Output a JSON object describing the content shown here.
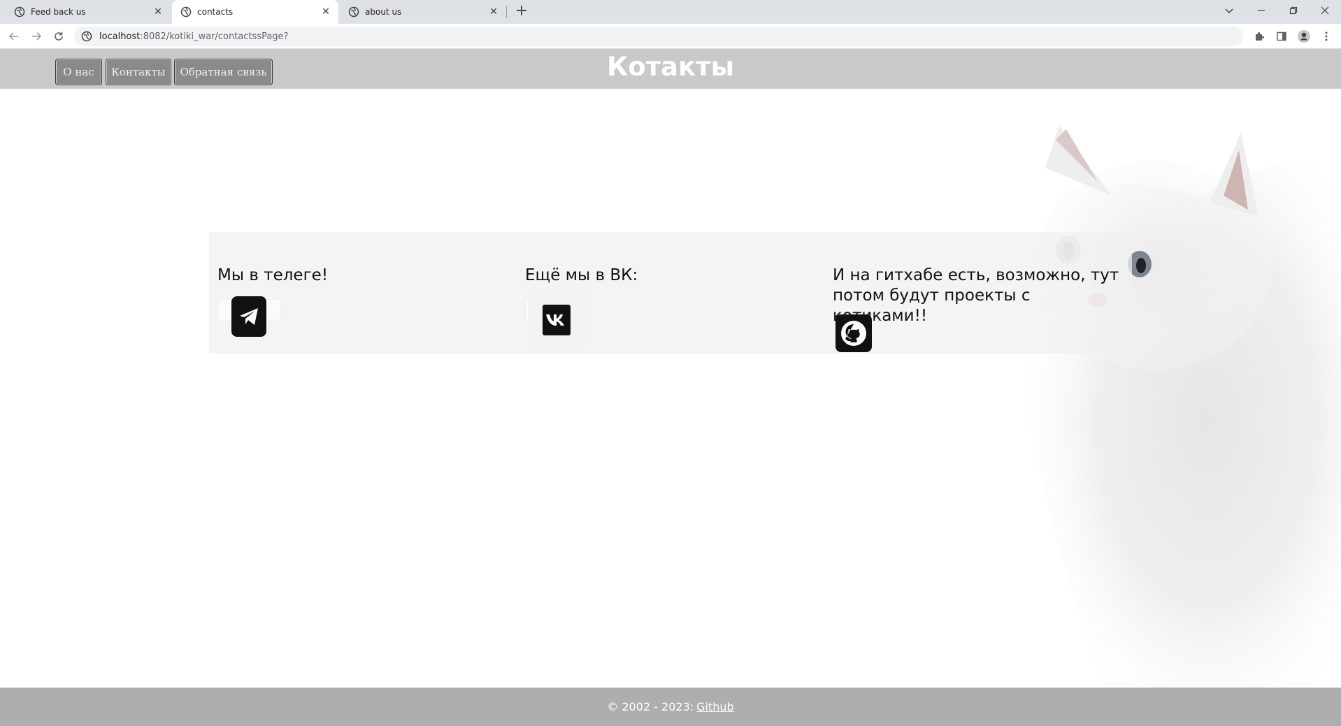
{
  "browser": {
    "tabs": [
      {
        "title": "Feed back us"
      },
      {
        "title": "contacts"
      },
      {
        "title": "about us"
      }
    ],
    "url_host": "localhost",
    "url_rest": ":8082/kotiki_war/contactssPage?"
  },
  "header": {
    "nav": [
      "О нас",
      "Контакты",
      "Обратная связь"
    ],
    "title": "Котакты"
  },
  "contacts": [
    {
      "heading": "Мы в телеге!",
      "icon": "telegram-icon"
    },
    {
      "heading": "Ещё мы в ВК:",
      "icon": "vk-icon"
    },
    {
      "heading": "И на гитхабе есть, возможно, тут потом будут проекты с котиками!!",
      "icon": "github-icon"
    }
  ],
  "footer": {
    "copyright": "© 2002 - 2023:",
    "link": "Github"
  }
}
